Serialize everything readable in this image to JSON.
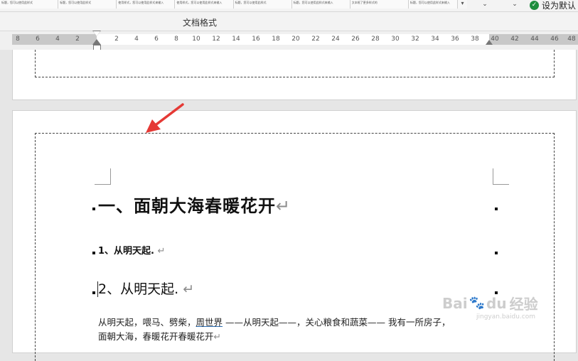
{
  "ribbon": {
    "gallery_items": [
      "标题，您可以使用此样式",
      "标题，您可以使用此样式",
      "使用样式，您可以使用此样式来输入",
      "使用样式，您可以使用此样式来输入",
      "标题，您可以使用此样式",
      "标题，您可以使用此样式来输入",
      "文本框了更多样式的",
      "标题，您可以使用此样式来输入"
    ],
    "group_label": "文档格式",
    "set_default_label": "设为默认"
  },
  "ruler": {
    "ticks": [
      "8",
      "6",
      "4",
      "2",
      "2",
      "4",
      "6",
      "8",
      "10",
      "12",
      "14",
      "16",
      "18",
      "20",
      "22",
      "24",
      "26",
      "28",
      "30",
      "32",
      "34",
      "36",
      "38",
      "40",
      "42",
      "44",
      "46",
      "48"
    ]
  },
  "document": {
    "heading1": "一、面朝大海春暖花开",
    "heading2": "1、从明天起.",
    "heading3": "2、从明天起.",
    "return_mark": "↵",
    "body_line1_a": "从明天起，喂马、劈柴，",
    "body_line1_link": "周世界",
    "body_line1_b": " ——从明天起——，关心粮食和蔬菜—— 我有一所房子，",
    "body_line2": "面朝大海，春暖花开春暖花开"
  },
  "watermark": {
    "text_a": "Bai",
    "text_b": "du",
    "text_cn": "经验",
    "url": "jingyan.baidu.com"
  }
}
